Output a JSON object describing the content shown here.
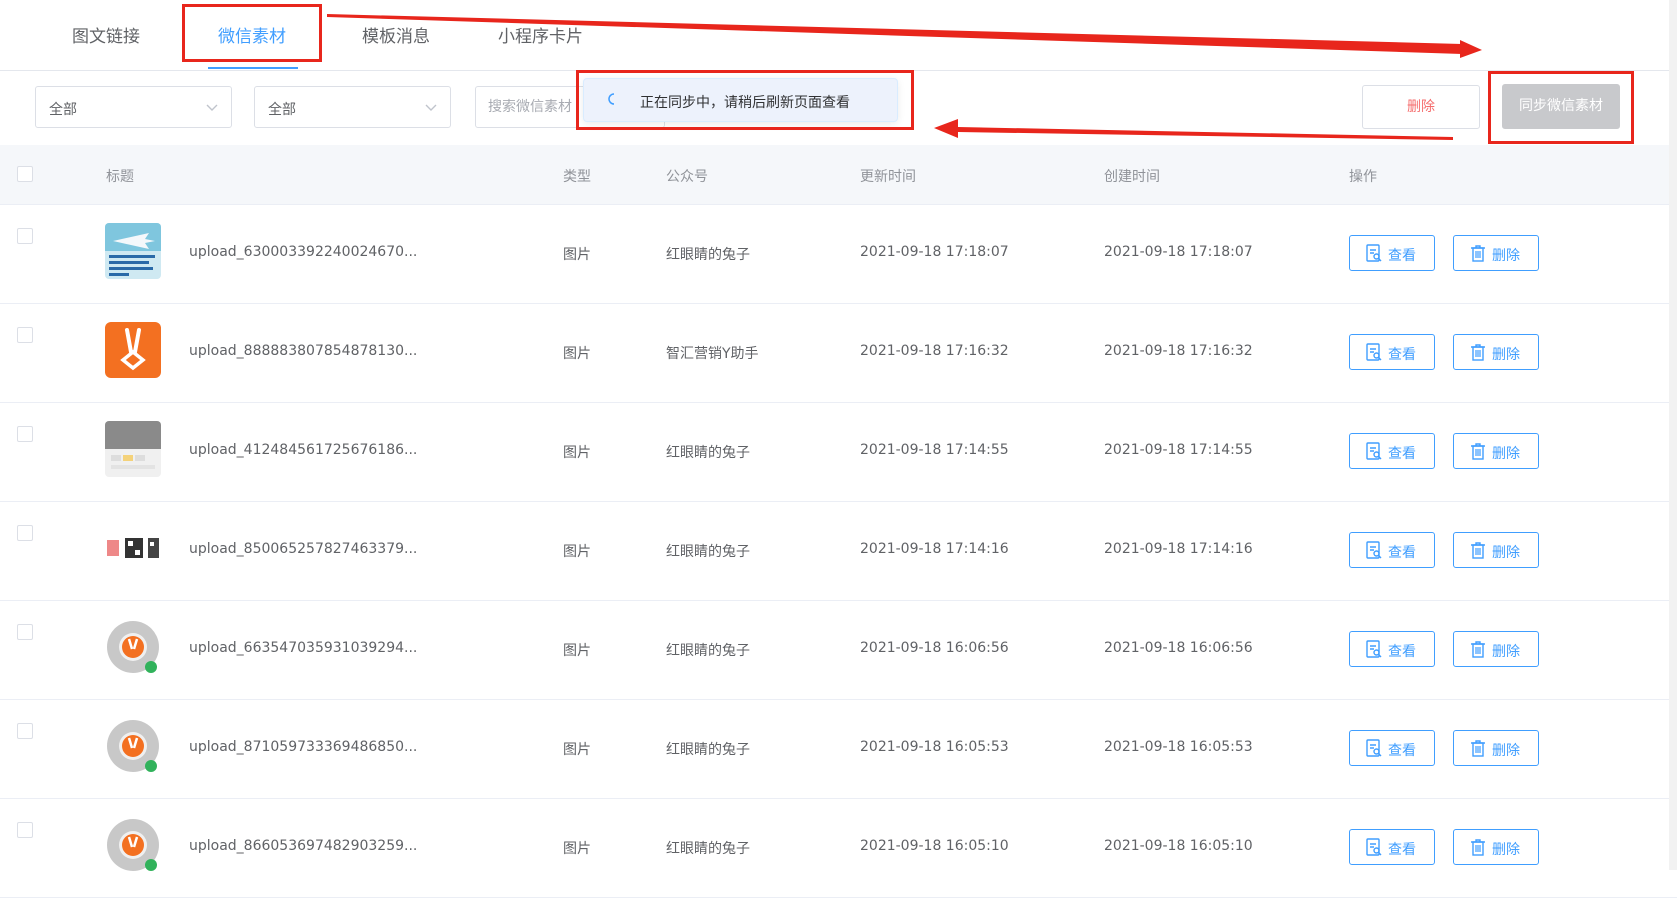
{
  "tabs": [
    {
      "label": "图文链接",
      "active": false
    },
    {
      "label": "微信素材",
      "active": true
    },
    {
      "label": "模板消息",
      "active": false
    },
    {
      "label": "小程序卡片",
      "active": false
    }
  ],
  "filters": {
    "select1": "全部",
    "select2": "全部",
    "search_placeholder": "搜索微信素材"
  },
  "toast": {
    "message": "正在同步中，请稍后刷新页面查看"
  },
  "toolbar": {
    "delete_label": "删除",
    "sync_label": "同步微信素材"
  },
  "table": {
    "headers": {
      "title": "标题",
      "type": "类型",
      "account": "公众号",
      "updated": "更新时间",
      "created": "创建时间",
      "actions": "操作"
    },
    "view_label": "查看",
    "delete_label": "删除",
    "rows": [
      {
        "thumb": "airplane-article",
        "title": "upload_630003392240024670...",
        "type": "图片",
        "account": "红眼睛的兔子",
        "updated": "2021-09-18 17:18:07",
        "created": "2021-09-18 17:18:07"
      },
      {
        "thumb": "orange-rabbit-logo",
        "title": "upload_888883807854878130...",
        "type": "图片",
        "account": "智汇营销Y助手",
        "updated": "2021-09-18 17:16:32",
        "created": "2021-09-18 17:16:32"
      },
      {
        "thumb": "grey-screenshot",
        "title": "upload_412484561725676186...",
        "type": "图片",
        "account": "红眼睛的兔子",
        "updated": "2021-09-18 17:14:55",
        "created": "2021-09-18 17:14:55"
      },
      {
        "thumb": "qr-codes-strip",
        "title": "upload_850065257827463379...",
        "type": "图片",
        "account": "红眼睛的兔子",
        "updated": "2021-09-18 17:14:16",
        "created": "2021-09-18 17:14:16"
      },
      {
        "thumb": "miniprogram-code",
        "title": "upload_663547035931039294...",
        "type": "图片",
        "account": "红眼睛的兔子",
        "updated": "2021-09-18 16:06:56",
        "created": "2021-09-18 16:06:56"
      },
      {
        "thumb": "miniprogram-code",
        "title": "upload_871059733369486850...",
        "type": "图片",
        "account": "红眼睛的兔子",
        "updated": "2021-09-18 16:05:53",
        "created": "2021-09-18 16:05:53"
      },
      {
        "thumb": "miniprogram-code",
        "title": "upload_866053697482903259...",
        "type": "图片",
        "account": "红眼睛的兔子",
        "updated": "2021-09-18 16:05:10",
        "created": "2021-09-18 16:05:10"
      }
    ]
  },
  "colors": {
    "accent": "#409eff",
    "danger": "#f56c6c",
    "annotation": "#e8261c"
  }
}
